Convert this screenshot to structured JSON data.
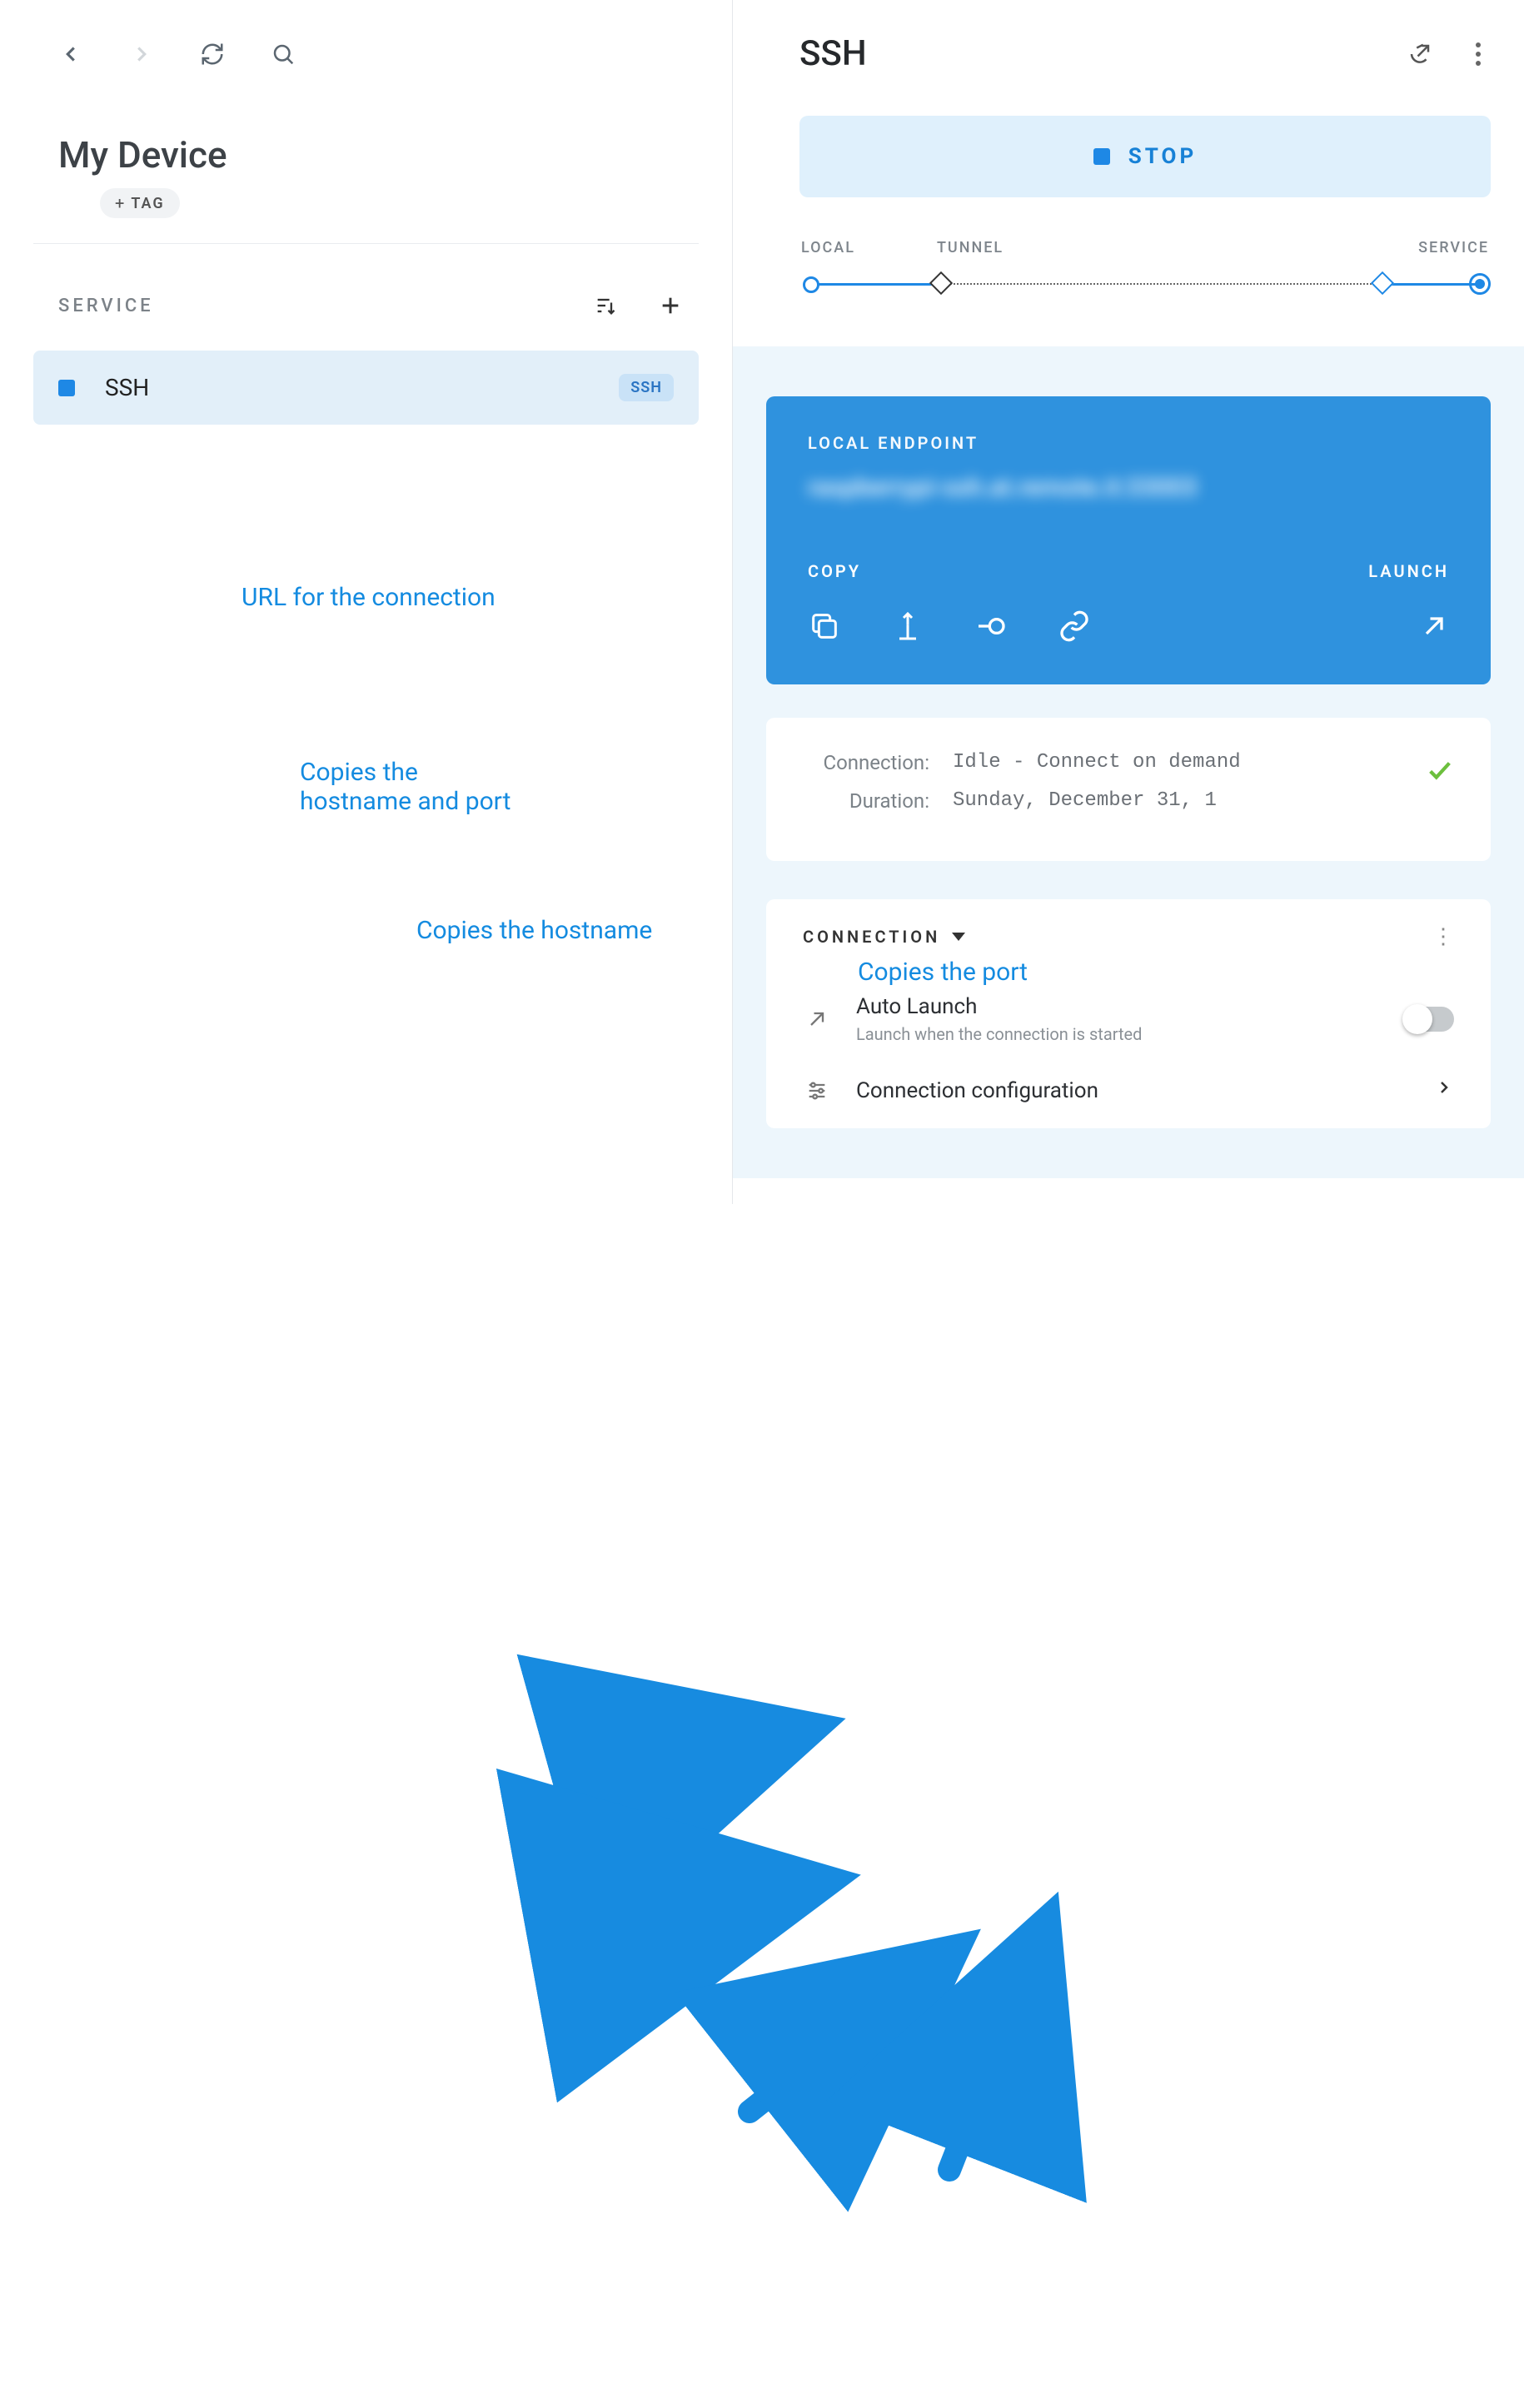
{
  "left": {
    "device_title": "My Device",
    "tag_label": "TAG",
    "service_heading": "SERVICE",
    "service": {
      "name": "SSH",
      "badge": "SSH"
    }
  },
  "right": {
    "title": "SSH",
    "stop_label": "STOP",
    "timeline": {
      "local": "LOCAL",
      "tunnel": "TUNNEL",
      "service": "SERVICE"
    },
    "endpoint": {
      "label": "LOCAL ENDPOINT",
      "url": "raspberrypi-ssh.at.remote.it:33003",
      "copy_label": "COPY",
      "launch_label": "LAUNCH"
    },
    "info": {
      "connection_key": "Connection:",
      "connection_val": "Idle - Connect on demand",
      "duration_key": "Duration:",
      "duration_val": "Sunday, December 31, 1"
    },
    "connection_section": {
      "heading": "CONNECTION",
      "auto_launch_title": "Auto Launch",
      "auto_launch_sub": "Launch when the connection is started",
      "conn_config_title": "Connection configuration"
    }
  },
  "annotations": {
    "url": "URL for the connection",
    "copy_both": "Copies the\nhostname and port",
    "copy_host": "Copies the hostname",
    "copy_port": "Copies the port"
  }
}
